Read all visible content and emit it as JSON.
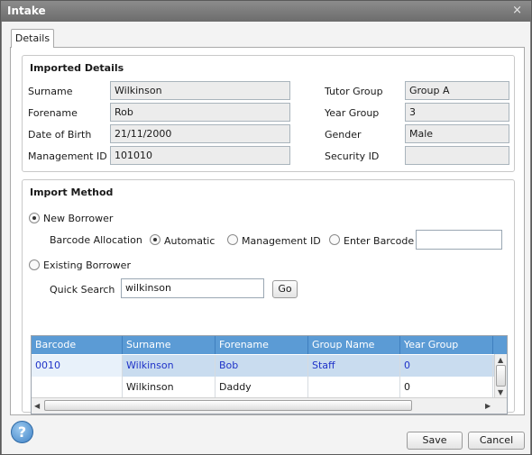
{
  "window": {
    "title": "Intake",
    "close_glyph": "×"
  },
  "tabs": [
    {
      "label": "Details"
    }
  ],
  "imported": {
    "title": "Imported Details",
    "fields": [
      {
        "label": "Surname",
        "value": "Wilkinson"
      },
      {
        "label": "Forename",
        "value": "Rob"
      },
      {
        "label": "Date of Birth",
        "value": "21/11/2000"
      },
      {
        "label": "Management ID",
        "value": "101010"
      },
      {
        "label": "Tutor Group",
        "value": "Group A"
      },
      {
        "label": "Year Group",
        "value": "3"
      },
      {
        "label": "Gender",
        "value": "Male"
      },
      {
        "label": "Security ID",
        "value": ""
      }
    ]
  },
  "import_method": {
    "title": "Import Method",
    "new_borrower": "New Borrower",
    "barcode_allocation": "Barcode Allocation",
    "automatic": "Automatic",
    "management_id": "Management ID",
    "enter_barcode": "Enter Barcode",
    "barcode_value": "",
    "existing_borrower": "Existing Borrower",
    "quick_search_label": "Quick Search",
    "quick_search_value": "wilkinson",
    "go": "Go",
    "selected": "new_borrower",
    "allocation_selected": "automatic"
  },
  "grid": {
    "columns": [
      "Barcode",
      "Surname",
      "Forename",
      "Group Name",
      "Year Group"
    ],
    "rows": [
      {
        "barcode": "0010",
        "surname": "Wilkinson",
        "forename": "Bob",
        "group": "Staff",
        "year": "0",
        "selected": true
      },
      {
        "barcode": "",
        "surname": "Wilkinson",
        "forename": "Daddy",
        "group": "",
        "year": "0",
        "selected": false
      }
    ]
  },
  "footer": {
    "help_glyph": "?",
    "save": "Save",
    "cancel": "Cancel"
  },
  "colors": {
    "header_blue": "#5b9bd5",
    "selected_row": "#c9dcef",
    "selected_text": "#1f33c8"
  }
}
